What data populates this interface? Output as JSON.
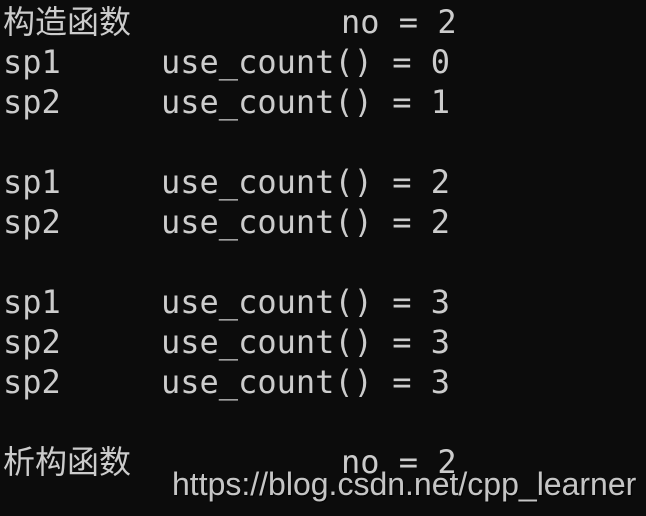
{
  "console": {
    "background": "#0c0c0c",
    "foreground": "#cccccc",
    "lines": [
      {
        "c1": "构造函数",
        "c2": "",
        "c3": "no = 2"
      },
      {
        "c1": "sp1",
        "c2": "use_count() = 0",
        "c3": ""
      },
      {
        "c1": "sp2",
        "c2": "use_count() = 1",
        "c3": ""
      },
      {
        "c1": "",
        "c2": "",
        "c3": ""
      },
      {
        "c1": "sp1",
        "c2": "use_count() = 2",
        "c3": ""
      },
      {
        "c1": "sp2",
        "c2": "use_count() = 2",
        "c3": ""
      },
      {
        "c1": "",
        "c2": "",
        "c3": ""
      },
      {
        "c1": "sp1",
        "c2": "use_count() = 3",
        "c3": ""
      },
      {
        "c1": "sp2",
        "c2": "use_count() = 3",
        "c3": ""
      },
      {
        "c1": "sp2",
        "c2": "use_count() = 3",
        "c3": ""
      },
      {
        "c1": "",
        "c2": "",
        "c3": ""
      },
      {
        "c1": "析构函数",
        "c2": "",
        "c3": "no = 2"
      }
    ]
  },
  "watermark": "https://blog.csdn.net/cpp_learner"
}
